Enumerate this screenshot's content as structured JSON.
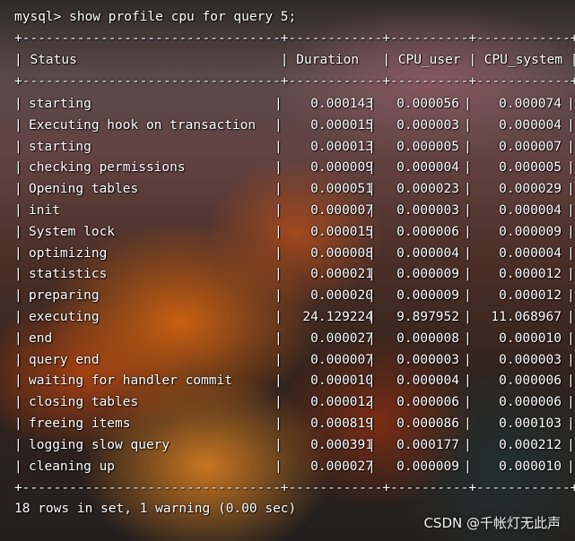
{
  "terminal": {
    "prompt": "mysql> show profile cpu for query 5;",
    "separator": "+---------------------------------+------------+----------+------------+",
    "header": "| Status                          | Duration   | CPU_user | CPU_system |",
    "footer": "18 rows in set, 1 warning (0.00 sec)",
    "bar": "|"
  },
  "rows": [
    {
      "status": "starting",
      "duration": "0.000143",
      "cpu_user": "0.000056",
      "cpu_system": "0.000074"
    },
    {
      "status": "Executing hook on transaction",
      "duration": "0.000015",
      "cpu_user": "0.000003",
      "cpu_system": "0.000004"
    },
    {
      "status": "starting",
      "duration": "0.000013",
      "cpu_user": "0.000005",
      "cpu_system": "0.000007"
    },
    {
      "status": "checking permissions",
      "duration": "0.000009",
      "cpu_user": "0.000004",
      "cpu_system": "0.000005"
    },
    {
      "status": "Opening tables",
      "duration": "0.000051",
      "cpu_user": "0.000023",
      "cpu_system": "0.000029"
    },
    {
      "status": "init",
      "duration": "0.000007",
      "cpu_user": "0.000003",
      "cpu_system": "0.000004"
    },
    {
      "status": "System lock",
      "duration": "0.000015",
      "cpu_user": "0.000006",
      "cpu_system": "0.000009"
    },
    {
      "status": "optimizing",
      "duration": "0.000008",
      "cpu_user": "0.000004",
      "cpu_system": "0.000004"
    },
    {
      "status": "statistics",
      "duration": "0.000021",
      "cpu_user": "0.000009",
      "cpu_system": "0.000012"
    },
    {
      "status": "preparing",
      "duration": "0.000020",
      "cpu_user": "0.000009",
      "cpu_system": "0.000012"
    },
    {
      "status": "executing",
      "duration": "24.129224",
      "cpu_user": "9.897952",
      "cpu_system": "11.068967"
    },
    {
      "status": "end",
      "duration": "0.000027",
      "cpu_user": "0.000008",
      "cpu_system": "0.000010"
    },
    {
      "status": "query end",
      "duration": "0.000007",
      "cpu_user": "0.000003",
      "cpu_system": "0.000003"
    },
    {
      "status": "waiting for handler commit",
      "duration": "0.000010",
      "cpu_user": "0.000004",
      "cpu_system": "0.000006"
    },
    {
      "status": "closing tables",
      "duration": "0.000012",
      "cpu_user": "0.000006",
      "cpu_system": "0.000006"
    },
    {
      "status": "freeing items",
      "duration": "0.000819",
      "cpu_user": "0.000086",
      "cpu_system": "0.000103"
    },
    {
      "status": "logging slow query",
      "duration": "0.000391",
      "cpu_user": "0.000177",
      "cpu_system": "0.000212"
    },
    {
      "status": "cleaning up",
      "duration": "0.000027",
      "cpu_user": "0.000009",
      "cpu_system": "0.000010"
    }
  ],
  "watermark": "CSDN @千帐灯无此声"
}
